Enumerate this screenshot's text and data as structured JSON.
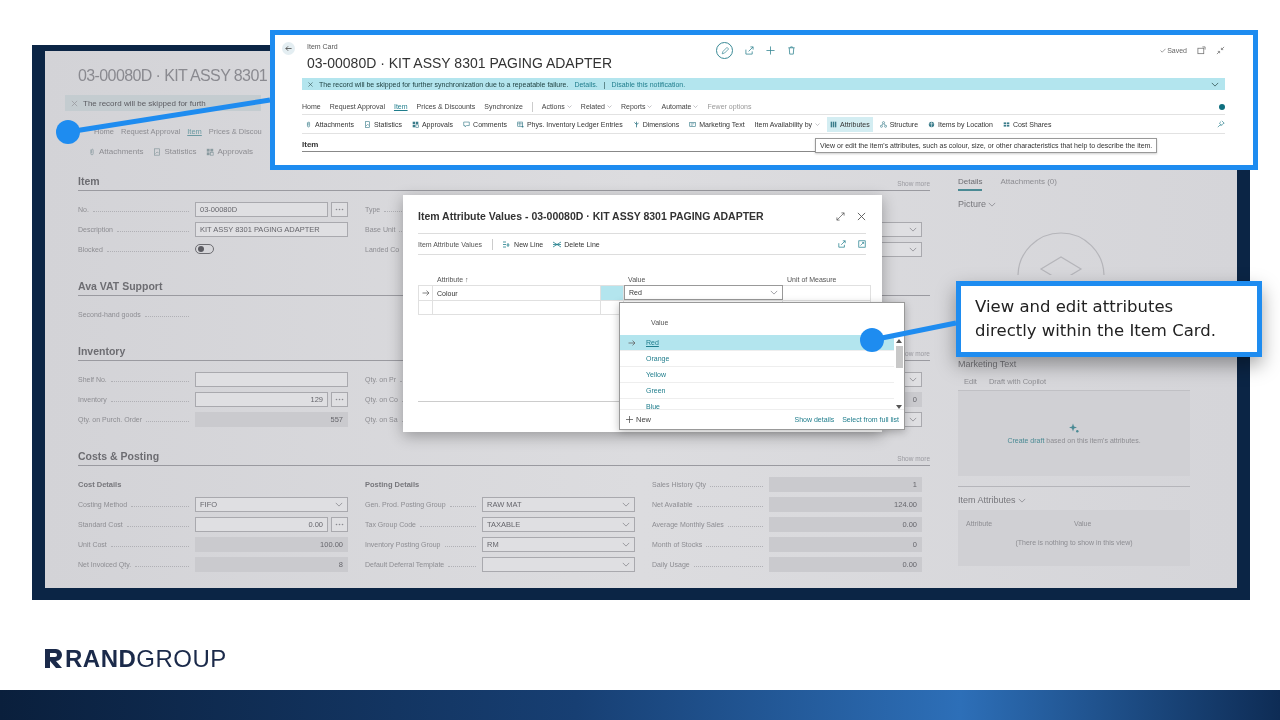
{
  "background_header": {
    "title": "03-00080D · KIT ASSY 8301",
    "notification": "The record will be skipped for furth",
    "nav_tabs": [
      {
        "label": "Home",
        "selected": false
      },
      {
        "label": "Request Approval",
        "selected": false
      },
      {
        "label": "Item",
        "selected": true
      },
      {
        "label": "Prices & Discou",
        "selected": false
      }
    ],
    "actions": [
      "Attachments",
      "Statistics",
      "Approvals"
    ]
  },
  "sections": [
    {
      "title": "Item",
      "show_more": "Show more",
      "columns": [
        {
          "fields": [
            {
              "label": "No.",
              "kind": "lookup",
              "value": "03-00080D"
            },
            {
              "label": "Description",
              "kind": "text",
              "value": "KIT ASSY 8301 PAGING ADAPTER"
            },
            {
              "label": "Blocked",
              "kind": "toggle",
              "on": false
            }
          ]
        },
        {
          "fields": [
            {
              "label": "Type",
              "kind": "label_only"
            },
            {
              "label": "Base Unit",
              "kind": "label_only"
            },
            {
              "label": "Landed Co",
              "kind": "label_only"
            }
          ]
        },
        {
          "fields": [
            {
              "kind": "spacer"
            },
            {
              "kind": "dropdown"
            },
            {
              "kind": "dropdown"
            }
          ]
        }
      ]
    },
    {
      "title": "Ava VAT Support",
      "columns": [
        {
          "fields": [
            {
              "label": "Second-hand goods",
              "kind": "label_only"
            }
          ]
        }
      ]
    },
    {
      "title": "Inventory",
      "show_more": "ow more",
      "columns": [
        {
          "fields": [
            {
              "label": "Shelf No.",
              "kind": "text"
            },
            {
              "label": "Inventory",
              "kind": "number_lookup",
              "value": "129"
            },
            {
              "label": "Qty. on Purch. Order",
              "kind": "number",
              "value": "557"
            }
          ]
        },
        {
          "fields": [
            {
              "label": "Qty. on Pr",
              "kind": "label_only"
            },
            {
              "label": "Qty. on Co",
              "kind": "label_only"
            },
            {
              "label": "Qty. on Sa",
              "kind": "label_only"
            }
          ]
        },
        {
          "fields": [
            {
              "kind": "dropdown"
            },
            {
              "kind": "number",
              "value": "0"
            },
            {
              "kind": "dropdown"
            }
          ]
        }
      ]
    },
    {
      "title": "Costs & Posting",
      "show_more": "Show more",
      "columns": [
        {
          "heading": "Cost Details",
          "fields": [
            {
              "label": "Costing Method",
              "kind": "dropdown",
              "value": "FIFO"
            },
            {
              "label": "Standard Cost",
              "kind": "number_lookup",
              "value": "0.00"
            },
            {
              "label": "Unit Cost",
              "kind": "number",
              "value": "100.00"
            },
            {
              "label": "Net Invoiced Qty.",
              "kind": "number",
              "value": "8"
            }
          ]
        },
        {
          "heading": "Posting Details",
          "fields": [
            {
              "label": "Gen. Prod. Posting Group",
              "kind": "dropdown",
              "value": "RAW MAT"
            },
            {
              "label": "Tax Group Code",
              "kind": "dropdown",
              "value": "TAXABLE"
            },
            {
              "label": "Inventory Posting Group",
              "kind": "dropdown",
              "value": "RM"
            },
            {
              "label": "Default Deferral Template",
              "kind": "dropdown"
            }
          ]
        },
        {
          "fields": [
            {
              "label": "Sales History Qty",
              "kind": "number",
              "value": "1"
            },
            {
              "label": "Net Available",
              "kind": "number",
              "value": "124.00"
            },
            {
              "label": "Average Monthly Sales",
              "kind": "number",
              "value": "0.00"
            },
            {
              "label": "Month of Stocks",
              "kind": "number",
              "value": "0"
            },
            {
              "label": "Daily Usage",
              "kind": "number",
              "value": "0.00"
            }
          ]
        }
      ]
    }
  ],
  "factbox": {
    "tabs": [
      {
        "label": "Details",
        "selected": true
      },
      {
        "label": "Attachments (0)",
        "selected": false
      }
    ],
    "picture_title": "Picture",
    "marketing": {
      "title": "Marketing Text",
      "actions": [
        "Edit",
        "Draft with Copilot"
      ],
      "link": "Create draft",
      "text": " based on this item's attributes."
    },
    "attributes": {
      "title": "Item Attributes",
      "columns": [
        "Attribute",
        "Value"
      ],
      "empty_text": "(There is nothing to show in this view)"
    }
  },
  "inset": {
    "breadcrumb": "Item Card",
    "title": "03-00080D · KIT ASSY 8301 PAGING ADAPTER",
    "status": "Saved",
    "notification": {
      "text": "The record will be skipped for further synchronization due to a repeatable failure.",
      "links": [
        "Details.",
        "Disable this notification."
      ],
      "link_separator": "|"
    },
    "nav_tabs": [
      {
        "label": "Home",
        "selected": false,
        "menu": false
      },
      {
        "label": "Request Approval",
        "selected": false,
        "menu": false
      },
      {
        "label": "Item",
        "selected": true,
        "menu": false
      },
      {
        "label": "Prices & Discounts",
        "selected": false,
        "menu": false
      },
      {
        "label": "Synchronize",
        "selected": false,
        "menu": false
      },
      {
        "label": "Actions",
        "selected": false,
        "menu": true
      },
      {
        "label": "Related",
        "selected": false,
        "menu": true
      },
      {
        "label": "Reports",
        "selected": false,
        "menu": true
      },
      {
        "label": "Automate",
        "selected": false,
        "menu": true
      }
    ],
    "fewer_options": "Fewer options",
    "actions": [
      {
        "label": "Attachments",
        "kind": "command",
        "hovered": false
      },
      {
        "label": "Statistics",
        "kind": "command",
        "hovered": false
      },
      {
        "label": "Approvals",
        "kind": "command",
        "hovered": false
      },
      {
        "label": "Comments",
        "kind": "command",
        "hovered": false
      },
      {
        "label": "Phys. Inventory Ledger Entries",
        "kind": "command",
        "hovered": false
      },
      {
        "label": "Dimensions",
        "kind": "command",
        "hovered": false
      },
      {
        "label": "Marketing Text",
        "kind": "command",
        "hovered": false
      },
      {
        "label": "Item Availability by",
        "kind": "menu",
        "hovered": false
      },
      {
        "label": "Attributes",
        "kind": "command",
        "hovered": true
      },
      {
        "label": "Structure",
        "kind": "command",
        "hovered": false
      },
      {
        "label": "Items by Location",
        "kind": "command",
        "hovered": false
      },
      {
        "label": "Cost Shares",
        "kind": "command",
        "hovered": false
      }
    ],
    "section_title": "Item",
    "tooltip": "View or edit the item's attributes, such as colour, size, or other characteristics that help to describe the item."
  },
  "dialog": {
    "title": "Item Attribute Values - 03-00080D · KIT ASSY 8301 PAGING ADAPTER",
    "toolbar_title": "Item Attribute Values",
    "actions": [
      "New Line",
      "Delete Line"
    ],
    "columns": [
      "Attribute ↑",
      "Value",
      "Unit of Measure"
    ],
    "rows": [
      {
        "attribute": "Colour",
        "value": "Red",
        "selected": true
      },
      {
        "selected": false
      }
    ]
  },
  "dropdown": {
    "column": "Value",
    "options": [
      {
        "label": "Red",
        "selected": true
      },
      {
        "label": "Orange",
        "selected": false
      },
      {
        "label": "Yellow",
        "selected": false
      },
      {
        "label": "Green",
        "selected": false
      },
      {
        "label": "Blue",
        "selected": false
      }
    ],
    "new": "New",
    "links": [
      "Show details",
      "Select from full list"
    ]
  },
  "callout": "View and edit attributes directly within the Item Card.",
  "logo": "**RAND**GROUP"
}
